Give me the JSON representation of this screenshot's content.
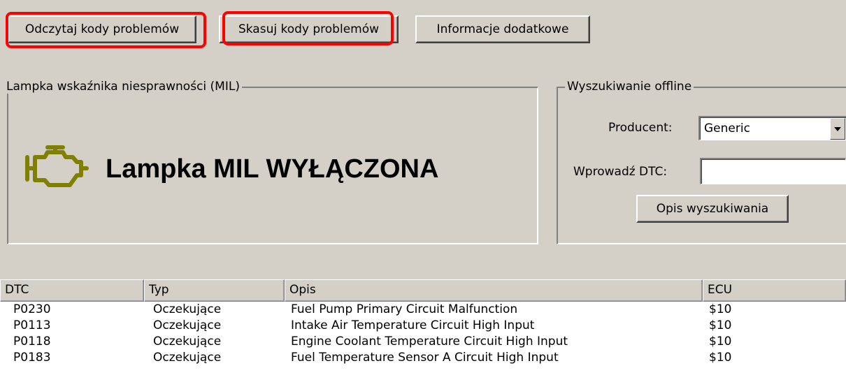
{
  "toolbar": {
    "read_codes_label": "Odczytaj kody problemów",
    "clear_codes_label": "Skasuj kody problemów",
    "additional_info_label": "Informacje dodatkowe"
  },
  "mil_group": {
    "title": "Lampka wskaźnika niesprawności (MIL)",
    "status_text": "Lampka MIL WYŁĄCZONA",
    "icon": "check-engine-icon",
    "icon_color": "#808000"
  },
  "search_group": {
    "title": "Wyszukiwanie offline",
    "manufacturer_label": "Producent:",
    "manufacturer_value": "Generic",
    "dtc_label": "Wprowadź DTC:",
    "dtc_value": "",
    "search_button_label": "Opis wyszukiwania"
  },
  "annotation_color": "#ff0000",
  "table": {
    "columns": [
      "DTC",
      "Typ",
      "Opis",
      "ECU"
    ],
    "rows": [
      [
        "P0230",
        "Oczekujące",
        "Fuel Pump Primary Circuit Malfunction",
        "$10"
      ],
      [
        "P0113",
        "Oczekujące",
        "Intake Air Temperature Circuit High Input",
        "$10"
      ],
      [
        "P0118",
        "Oczekujące",
        "Engine Coolant Temperature Circuit High Input",
        "$10"
      ],
      [
        "P0183",
        "Oczekujące",
        "Fuel Temperature Sensor A Circuit High Input",
        "$10"
      ]
    ]
  }
}
